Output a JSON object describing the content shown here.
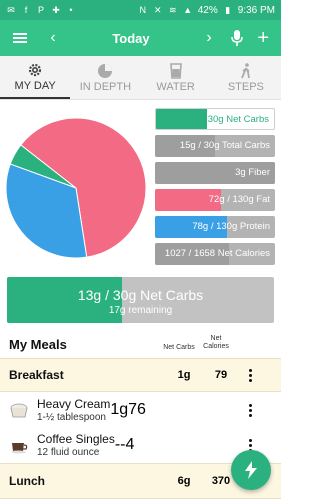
{
  "status_bar": {
    "battery": "42%",
    "time": "9:36 PM"
  },
  "app_bar": {
    "date_label": "Today"
  },
  "tabs": [
    {
      "label": "MY DAY",
      "active": true,
      "icon": "gear-icon"
    },
    {
      "label": "IN DEPTH",
      "active": false,
      "icon": "pie-chart-icon"
    },
    {
      "label": "WATER",
      "active": false,
      "icon": "water-glass-icon"
    },
    {
      "label": "STEPS",
      "active": false,
      "icon": "walker-icon"
    }
  ],
  "pie": {
    "slices": [
      {
        "name": "Carbs",
        "fraction": 0.05,
        "color": "#2bb17f"
      },
      {
        "name": "Fat",
        "fraction": 0.62,
        "color": "#f36a85"
      },
      {
        "name": "Protein",
        "fraction": 0.33,
        "color": "#3aa0e6"
      }
    ]
  },
  "macros": [
    {
      "text": "13g / 30g Net Carbs",
      "progress": 0.43,
      "style": "green"
    },
    {
      "text": "15g / 30g Total Carbs",
      "progress": 0.5,
      "style": "gray"
    },
    {
      "text": "3g Fiber",
      "progress": 1.0,
      "style": "gray"
    },
    {
      "text": "72g / 130g Fat",
      "progress": 0.55,
      "style": "red"
    },
    {
      "text": "78g / 130g Protein",
      "progress": 0.6,
      "style": "blue"
    },
    {
      "text": "1027 / 1658 Net Calories",
      "progress": 0.62,
      "style": "gray"
    }
  ],
  "net_carbs_bar": {
    "main": "13g / 30g Net Carbs",
    "remaining": "17g remaining",
    "progress": 0.43
  },
  "meals": {
    "title": "My Meals",
    "col_net_carbs": "Net Carbs",
    "col_net_calories_line1": "Net",
    "col_net_calories_line2": "Calories",
    "breakfast": {
      "label": "Breakfast",
      "net_carbs": "1g",
      "calories": "79"
    },
    "foods": [
      {
        "name": "Heavy Cream",
        "serving": "1-½ tablespoon",
        "net_carbs": "1g",
        "calories": "76"
      },
      {
        "name": "Coffee Singles",
        "serving": "12 fluid ounce",
        "net_carbs": "--",
        "calories": "4"
      }
    ],
    "lunch": {
      "label": "Lunch",
      "net_carbs": "6g",
      "calories": "370"
    }
  },
  "colors": {
    "primary": "#34c389",
    "dark_green": "#2bb17f",
    "fat": "#f36a85",
    "protein": "#3aa0e6",
    "gray": "#b3b3b3"
  }
}
